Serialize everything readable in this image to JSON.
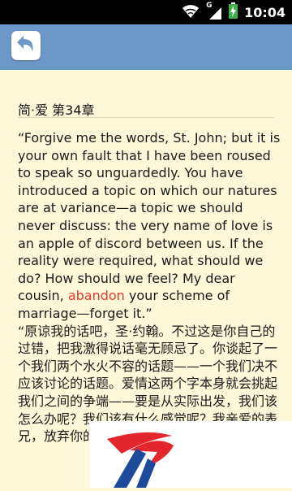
{
  "status_bar": {
    "time": "10:04",
    "icons": [
      "wifi-icon",
      "signal-g-icon",
      "battery-charging-icon"
    ],
    "network_label": "G"
  },
  "toolbar": {
    "back_icon": "back-arrow-icon"
  },
  "chapter": {
    "title": "简·爱 第34章"
  },
  "reading": {
    "en_before": "“Forgive me the words, St. John; but it is your own fault that I have been roused to speak so unguardedly. You have introduced a topic on which our natures are at variance—a topic we should never discuss: the very name of love is an apple of discord between us. If the reality were required, what should we do? How should we feel? My dear cousin, ",
    "highlight_word": "abandon",
    "en_after": " your scheme of marriage—forget it.”",
    "zh": "“原谅我的话吧，圣·约翰。不过这是你自己的过错，把我激得说话毫无顾忌了。你谈起了一个我们两个水火不容的话题——一个我们决不应该讨论的话题。爱情这两个字本身就会挑起我们之间的争端——要是从实际出发，我们该怎么办呢？我们该有什么感觉呢？我亲爱的表兄，放弃你的结婚计划吧——把它忘掉它。”"
  },
  "colors": {
    "page_background": "#fdf8d8",
    "toolbar": "#6c98c8",
    "highlight": "#e03a2c",
    "watermark_red": "#e3262b",
    "watermark_blue": "#1e4a9c"
  },
  "watermark_icon": "app-logo-watermark"
}
